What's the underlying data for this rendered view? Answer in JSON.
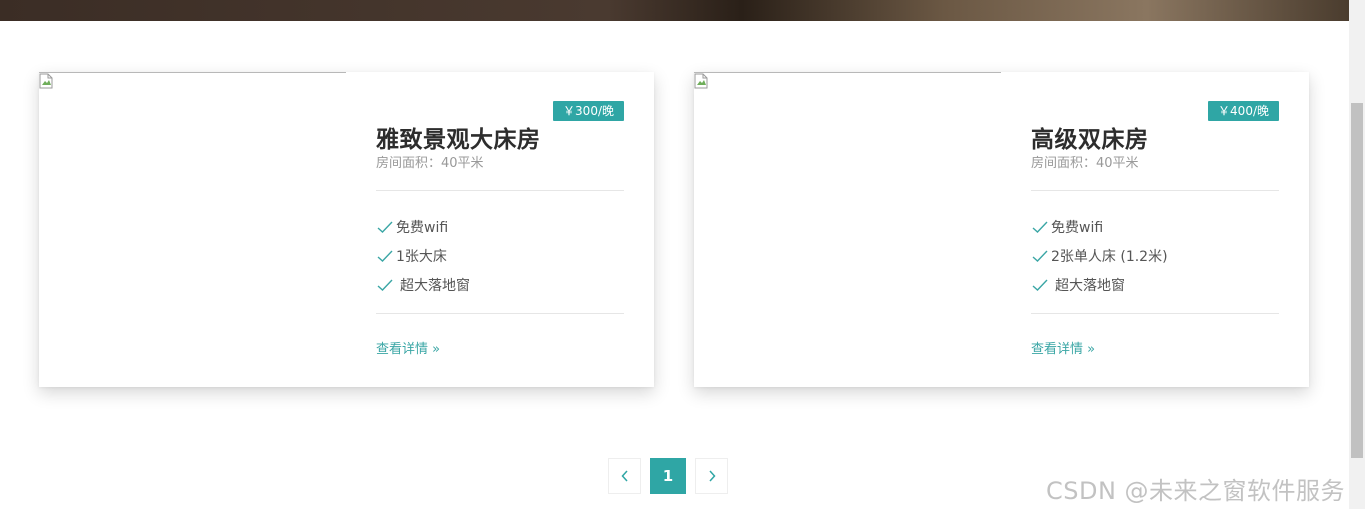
{
  "rooms": [
    {
      "price": "￥300/晚",
      "title": "雅致景观大床房",
      "area": "房间面积：40平米",
      "features": [
        "免费wifi",
        "1张大床",
        "超大落地窗"
      ],
      "link": "查看详情 »"
    },
    {
      "price": "￥400/晚",
      "title": "高级双床房",
      "area": "房间面积：40平米",
      "features": [
        "免费wifi",
        "2张单人床 (1.2米)",
        "超大落地窗"
      ],
      "link": "查看详情 »"
    }
  ],
  "pagination": {
    "prev_icon": "chevron-left-icon",
    "current": "1",
    "next_icon": "chevron-right-icon"
  },
  "watermark": "CSDN @未来之窗软件服务",
  "colors": {
    "accent": "#2fa6a5",
    "link": "#3aa6a5"
  }
}
